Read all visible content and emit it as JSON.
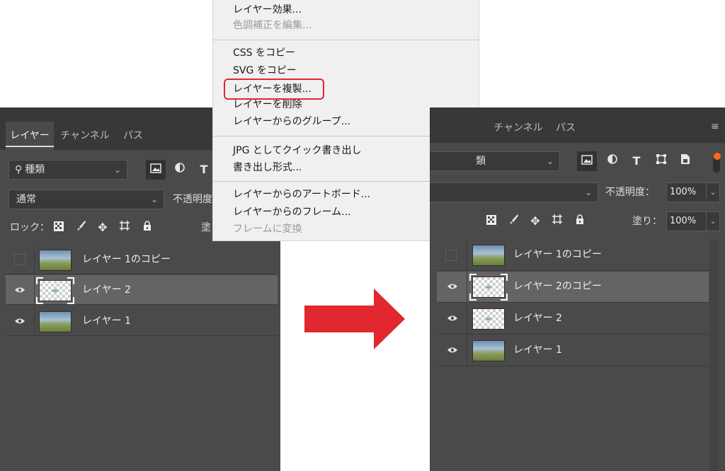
{
  "left_panel": {
    "tabs": [
      "レイヤー",
      "チャンネル",
      "パス"
    ],
    "search": {
      "icon": "magnifier-icon",
      "label": "種類"
    },
    "filter_icons": [
      "image-filter-icon",
      "adjustment-filter-icon",
      "type-filter-icon"
    ],
    "blend_mode": "通常",
    "opacity_label": "不透明度",
    "lock_label": "ロック：",
    "fill_label_partial": "塗",
    "lock_icons": [
      "lock-transparent-pixels-icon",
      "lock-image-pixels-icon",
      "lock-position-icon",
      "lock-artboard-icon",
      "lock-all-icon"
    ],
    "layers": [
      {
        "name": "レイヤー 1のコピー",
        "visible": false,
        "thumb": "photo",
        "selected": false
      },
      {
        "name": "レイヤー 2",
        "visible": true,
        "thumb": "transparent",
        "selected": true
      },
      {
        "name": "レイヤー 1",
        "visible": true,
        "thumb": "photo",
        "selected": false
      }
    ]
  },
  "context_menu": {
    "items": [
      {
        "label": "レイヤー効果...",
        "disabled": false
      },
      {
        "label": "色調補正を編集...",
        "disabled": true
      },
      {
        "label": "CSS をコピー",
        "disabled": false
      },
      {
        "label": "SVG をコピー",
        "disabled": false
      },
      {
        "label": "レイヤーを複製...",
        "disabled": false,
        "highlighted": true
      },
      {
        "label": "レイヤーを削除",
        "disabled": false
      },
      {
        "label": "レイヤーからのグループ...",
        "disabled": false
      },
      {
        "label": "JPG としてクイック書き出し",
        "disabled": false
      },
      {
        "label": "書き出し形式...",
        "disabled": false
      },
      {
        "label": "レイヤーからのアートボード...",
        "disabled": false
      },
      {
        "label": "レイヤーからのフレーム...",
        "disabled": false
      },
      {
        "label": "フレームに変換",
        "disabled": true
      }
    ],
    "highlight_color": "#e0282e"
  },
  "arrow": {
    "color": "#e0282e"
  },
  "right_panel": {
    "tabs": [
      "チャンネル",
      "パス"
    ],
    "search_partial": "類",
    "filter_icons": [
      "image-filter-icon",
      "adjustment-filter-icon",
      "type-filter-icon",
      "shape-filter-icon",
      "smart-object-filter-icon"
    ],
    "opacity_label": "不透明度：",
    "opacity_value": "100%",
    "fill_label": "塗り：",
    "fill_value": "100%",
    "layers": [
      {
        "name": "レイヤー 1のコピー",
        "visible": false,
        "thumb": "photo",
        "selected": false
      },
      {
        "name": "レイヤー 2のコピー",
        "visible": true,
        "thumb": "transparent",
        "selected": true
      },
      {
        "name": "レイヤー 2",
        "visible": true,
        "thumb": "transparent",
        "selected": false
      },
      {
        "name": "レイヤー 1",
        "visible": true,
        "thumb": "photo",
        "selected": false
      }
    ]
  }
}
